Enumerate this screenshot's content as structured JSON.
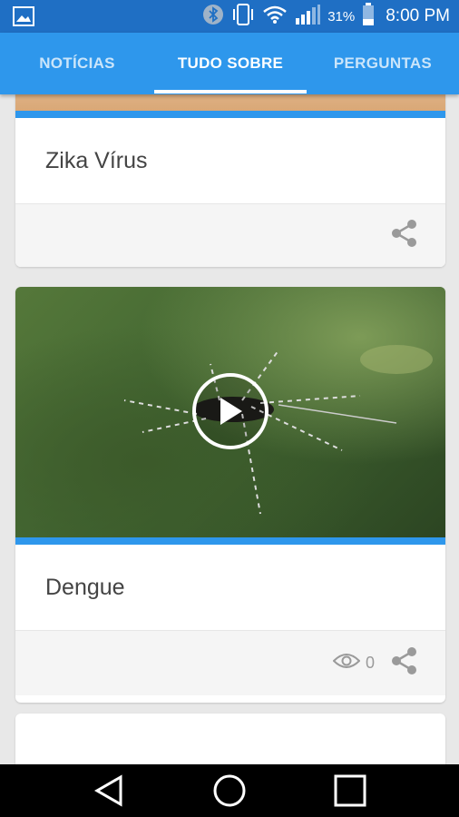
{
  "status_bar": {
    "battery_percent": "31%",
    "time": "8:00 PM",
    "icons": [
      "image-icon",
      "bluetooth-icon",
      "vibrate-icon",
      "wifi-icon",
      "signal-icon",
      "battery-icon"
    ]
  },
  "tabs": [
    {
      "label": "NOTÍCIAS",
      "selected": false
    },
    {
      "label": "TUDO SOBRE",
      "selected": true
    },
    {
      "label": "PERGUNTAS",
      "selected": false
    }
  ],
  "cards": [
    {
      "title": "Zika Vírus",
      "has_video": false
    },
    {
      "title": "Dengue",
      "has_video": true,
      "views": "0"
    }
  ],
  "colors": {
    "status_bar": "#1f6fc4",
    "tab_bar": "#2e97ec",
    "accent": "#2e97ec",
    "background": "#e8e8e8"
  },
  "nav": [
    "back-icon",
    "home-icon",
    "recents-icon"
  ]
}
